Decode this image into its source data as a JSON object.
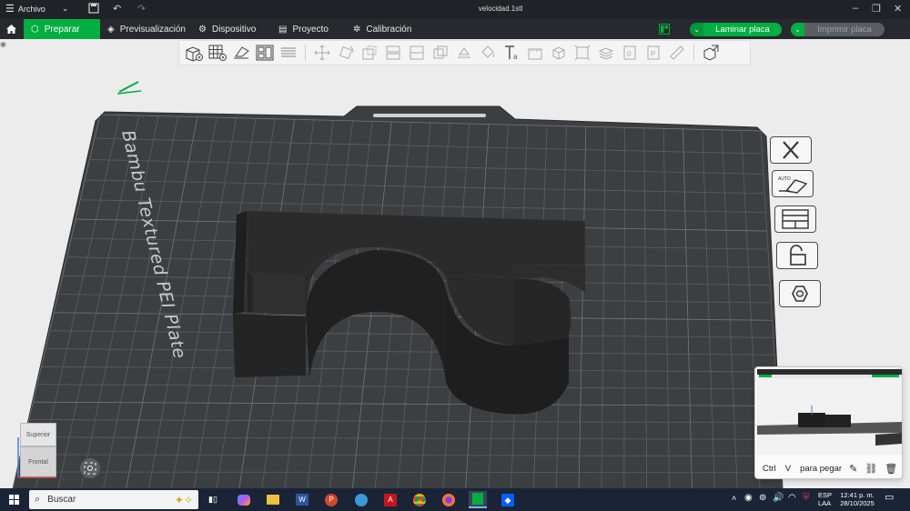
{
  "titlebar": {
    "menu_label": "Archivo",
    "window_title": "velocidad.1stl"
  },
  "tabs": [
    {
      "label": "Preparar",
      "active": true,
      "icon": "cube-icon"
    },
    {
      "label": "Previsualización",
      "active": false,
      "icon": "layers-icon"
    },
    {
      "label": "Dispositivo",
      "active": false,
      "icon": "device-icon"
    },
    {
      "label": "Proyecto",
      "active": false,
      "icon": "project-icon"
    },
    {
      "label": "Calibración",
      "active": false,
      "icon": "calibration-icon"
    }
  ],
  "actions": {
    "slice_label": "Laminar placa",
    "print_label": "Imprimir placa"
  },
  "plate": {
    "name": "Bambu Textured PEI Plate"
  },
  "view_cube": {
    "top_label": "Superior",
    "front_label": "Frontal",
    "axis_x": "x"
  },
  "clipboard_popup": {
    "key_ctrl": "Ctrl",
    "key_v": "V",
    "hint": "para pegar"
  },
  "taskbar": {
    "search_placeholder": "Buscar",
    "lang_top": "ESP",
    "lang_bottom": "LAA",
    "time": "12:41 p. m.",
    "date": "28/10/2025"
  },
  "colors": {
    "brand_green": "#00ae42",
    "plate": "#3a3d40",
    "model": "#262626"
  }
}
